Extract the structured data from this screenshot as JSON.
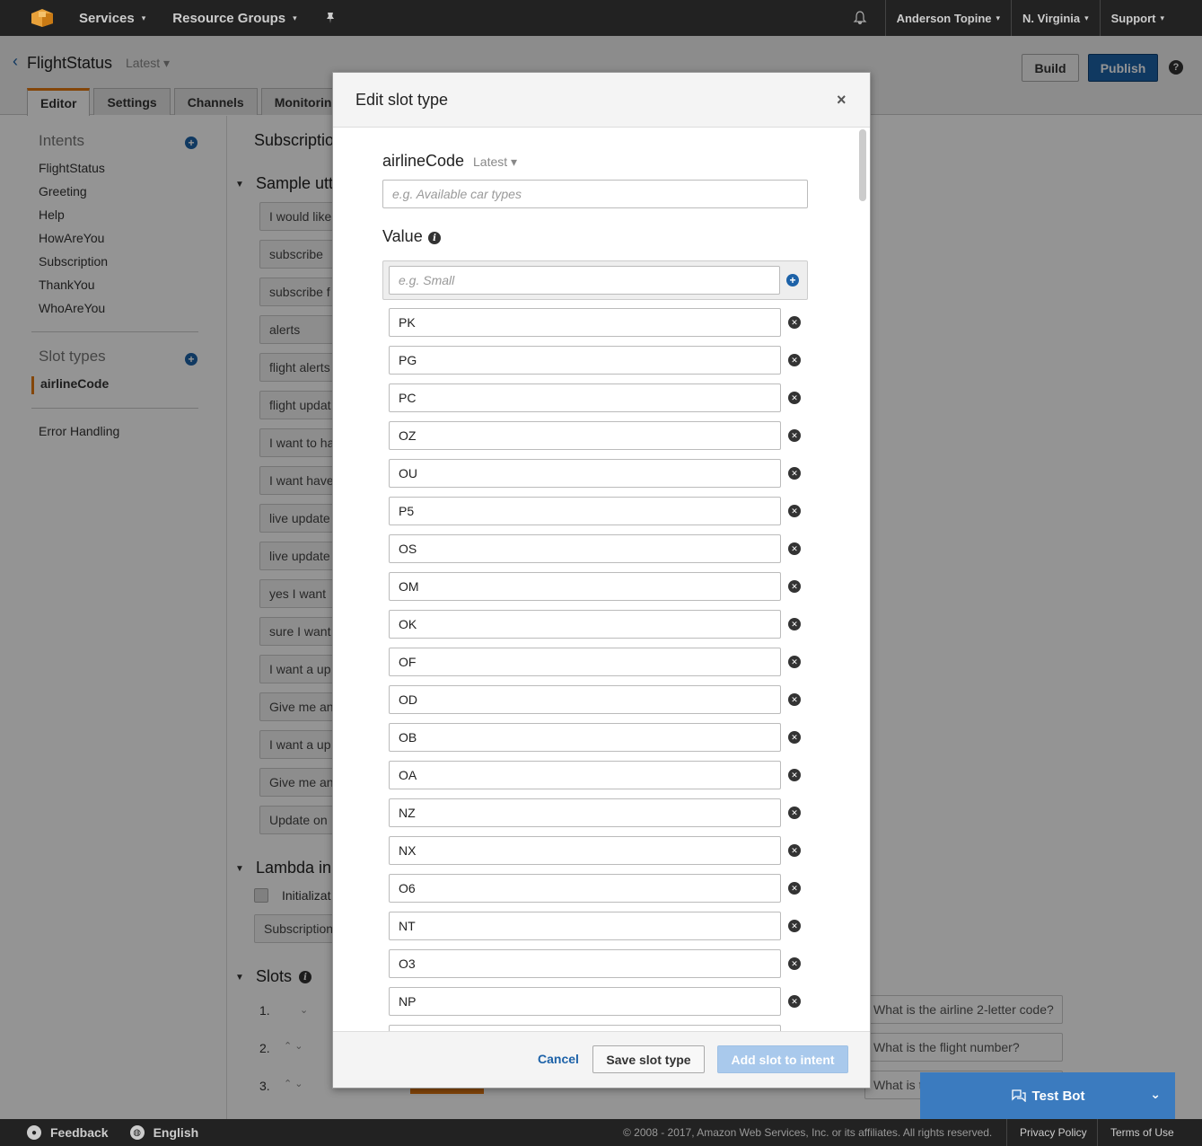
{
  "topnav": {
    "services": "Services",
    "resource_groups": "Resource Groups",
    "user": "Anderson Topine",
    "region": "N. Virginia",
    "support": "Support",
    "caret": "▾"
  },
  "header": {
    "bot_name": "FlightStatus",
    "version": "Latest ▾",
    "build": "Build",
    "publish": "Publish",
    "help": "?"
  },
  "tabs": [
    "Editor",
    "Settings",
    "Channels",
    "Monitorin"
  ],
  "sidebar": {
    "intents_heading": "Intents",
    "intents": [
      "FlightStatus",
      "Greeting",
      "Help",
      "HowAreYou",
      "Subscription",
      "ThankYou",
      "WhoAreYou"
    ],
    "slot_types_heading": "Slot types",
    "slot_types": [
      "airlineCode"
    ],
    "error_handling": "Error Handling"
  },
  "main": {
    "intent_title": "Subscriptio",
    "sample_heading": "Sample utt",
    "utterances": [
      "I would like",
      "subscribe",
      "subscribe f",
      "alerts",
      "flight alerts",
      "flight updat",
      "I want to ha",
      "I want have",
      "live update",
      "live update",
      "yes I want",
      "sure I want",
      "I want a up",
      "Give me an",
      "I want a up",
      "Give me an",
      "Update on"
    ],
    "lambda_heading": "Lambda in",
    "lambda_checkbox": "Initializat",
    "lambda_select": "Subscription",
    "slots_heading": "Slots",
    "slot_numbers": [
      "1.",
      "2.",
      "3."
    ],
    "prompts": [
      "What is the airline 2-letter code?",
      "What is the flight number?",
      "What is t"
    ],
    "test_bot": "Test Bot"
  },
  "modal": {
    "title": "Edit slot type",
    "close": "×",
    "slot_name": "airlineCode",
    "slot_version": "Latest ▾",
    "description_placeholder": "e.g. Available car types",
    "value_label": "Value",
    "new_value_placeholder": "e.g. Small",
    "values": [
      "PK",
      "PG",
      "PC",
      "OZ",
      "OU",
      "P5",
      "OS",
      "OM",
      "OK",
      "OF",
      "OD",
      "OB",
      "OA",
      "NZ",
      "NX",
      "O6",
      "NT",
      "O3",
      "NP"
    ],
    "cancel": "Cancel",
    "save": "Save slot type",
    "add_to_intent": "Add slot to intent"
  },
  "footer": {
    "feedback": "Feedback",
    "language": "English",
    "copyright": "© 2008 - 2017, Amazon Web Services, Inc. or its affiliates. All rights reserved.",
    "privacy": "Privacy Policy",
    "terms": "Terms of Use"
  },
  "colors": {
    "accent": "#e47911",
    "primary": "#1d62a8",
    "nav_bg": "#222222"
  }
}
